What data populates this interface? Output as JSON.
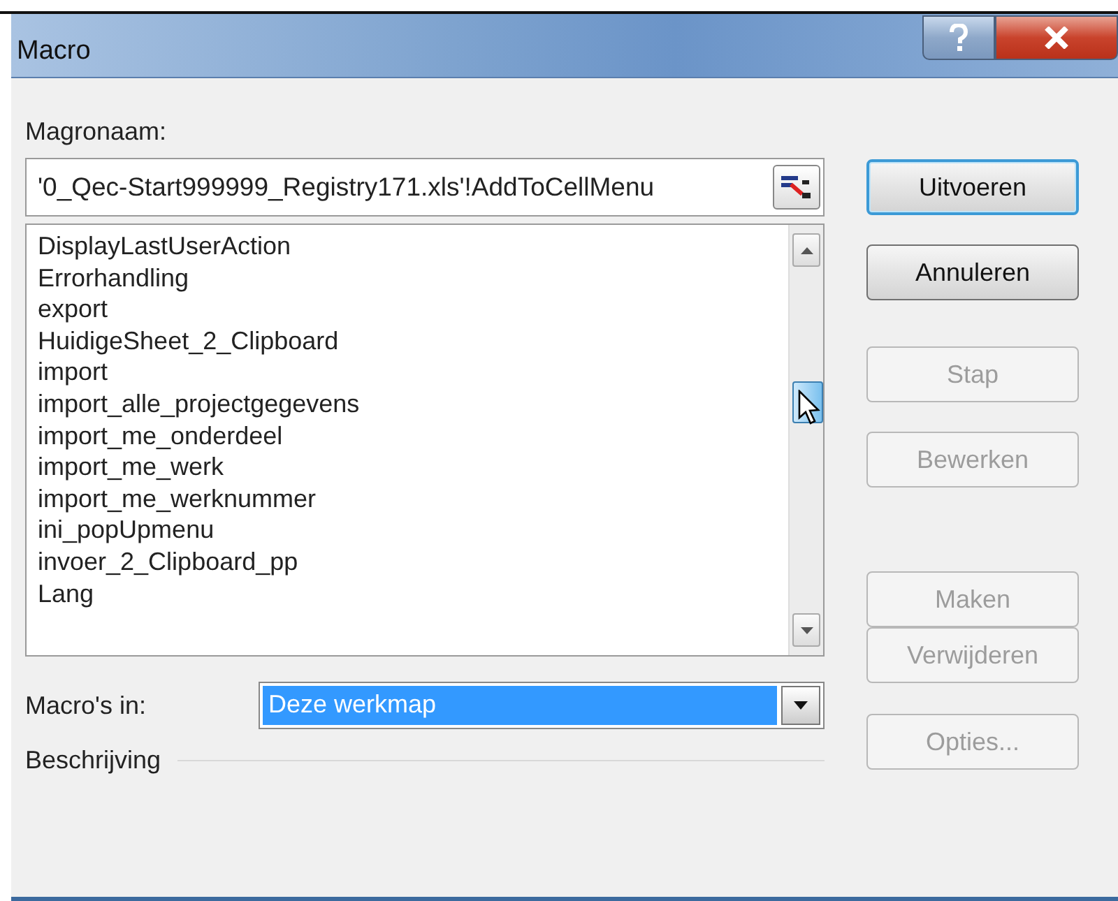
{
  "window": {
    "title": "Macro"
  },
  "macro_name": {
    "label": "Magronaam:",
    "value": "'0_Qec-Start999999_Registry171.xls'!AddToCellMenu"
  },
  "macro_list": [
    {
      "name": "DisplayLastUserAction"
    },
    {
      "name": "Errorhandling"
    },
    {
      "name": "export"
    },
    {
      "name": "HuidigeSheet_2_Clipboard"
    },
    {
      "name": "import"
    },
    {
      "name": "import_alle_projectgegevens"
    },
    {
      "name": "import_me_onderdeel"
    },
    {
      "name": "import_me_werk"
    },
    {
      "name": "import_me_werknummer"
    },
    {
      "name": "ini_popUpmenu"
    },
    {
      "name": "invoer_2_Clipboard_pp"
    },
    {
      "name": "Lang"
    }
  ],
  "macros_in": {
    "label": "Macro's in:",
    "value": "Deze werkmap"
  },
  "description": {
    "label": "Beschrijving"
  },
  "buttons": [
    {
      "label": "Uitvoeren",
      "disabled": false,
      "default": true
    },
    {
      "label": "Annuleren",
      "disabled": false,
      "default": false
    },
    {
      "label": "Stap",
      "disabled": true,
      "default": false
    },
    {
      "label": "Bewerken",
      "disabled": true,
      "default": false
    },
    {
      "label": "Maken",
      "disabled": true,
      "default": false
    },
    {
      "label": "Verwijderen",
      "disabled": true,
      "default": false
    },
    {
      "label": "Opties...",
      "disabled": true,
      "default": false
    }
  ]
}
